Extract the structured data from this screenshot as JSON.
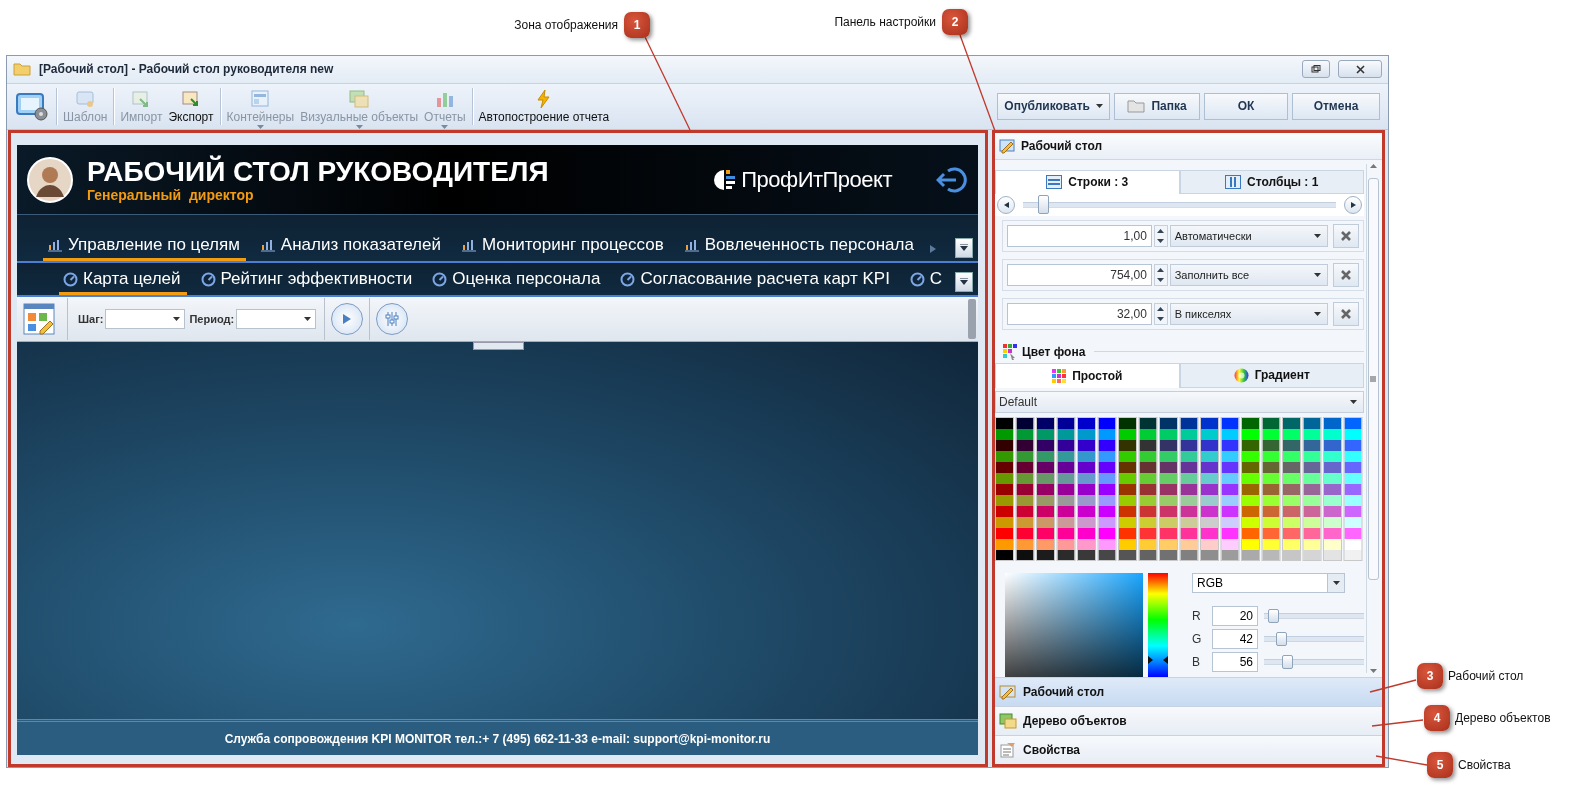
{
  "annotations": [
    {
      "number": "1",
      "label": "Зона отображения"
    },
    {
      "number": "2",
      "label": "Панель настройки"
    },
    {
      "number": "3",
      "label": "Рабочий стол"
    },
    {
      "number": "4",
      "label": "Дерево объектов"
    },
    {
      "number": "5",
      "label": "Свойства"
    }
  ],
  "window": {
    "title": "[Рабочий стол] - Рабочий стол руководителя new"
  },
  "toolbar": {
    "items": [
      {
        "kind": "icon",
        "disabled": false
      },
      {
        "kind": "button",
        "label": "Шаблон",
        "disabled": true,
        "group_start": true
      },
      {
        "kind": "button",
        "label": "Импорт",
        "disabled": true,
        "group_start": true
      },
      {
        "kind": "button",
        "label": "Экспорт",
        "disabled": false
      },
      {
        "kind": "dropdown",
        "label": "Контейнеры",
        "disabled": true,
        "group_start": true
      },
      {
        "kind": "dropdown",
        "label": "Визуальные объекты",
        "disabled": true
      },
      {
        "kind": "dropdown",
        "label": "Отчеты",
        "disabled": true
      },
      {
        "kind": "button",
        "label": "Автопостроение отчета",
        "disabled": false,
        "group_start": true
      }
    ],
    "actions": [
      {
        "kind": "dropdown",
        "label": "Опубликовать"
      },
      {
        "kind": "folder",
        "label": "Папка"
      },
      {
        "kind": "plain",
        "label": "ОК"
      },
      {
        "kind": "plain",
        "label": "Отмена"
      }
    ]
  },
  "dashboard": {
    "title": "РАБОЧИЙ СТОЛ РУКОВОДИТЕЛЯ",
    "subtitle": "Генеральный  директор",
    "brand": "ПрофИтПроект",
    "tabs": [
      {
        "label": "Управление по целям",
        "selected": true
      },
      {
        "label": "Анализ показателей",
        "selected": false
      },
      {
        "label": "Мониторинг процессов",
        "selected": false
      },
      {
        "label": "Вовлеченность персонала",
        "selected": false
      }
    ],
    "subtabs": [
      {
        "label": "Карта целей",
        "selected": true
      },
      {
        "label": "Рейтинг эффективности",
        "selected": false
      },
      {
        "label": "Оценка персонала",
        "selected": false
      },
      {
        "label": "Согласование расчета карт KPI",
        "selected": false
      },
      {
        "label": "С",
        "selected": false
      }
    ],
    "filters": [
      {
        "label": "Шаг:"
      },
      {
        "label": "Период:"
      }
    ],
    "footer": "Служба сопровождения KPI MONITOR тел.:+ 7 (495) 662-11-33 e-mail: support@kpi-monitor.ru"
  },
  "panel": {
    "title": "Рабочий стол",
    "tabs": [
      {
        "label": "Строки : 3",
        "selected": true
      },
      {
        "label": "Столбцы : 1",
        "selected": false
      }
    ],
    "slider": {
      "level": 0.06
    },
    "rows": [
      {
        "value": "1,00",
        "mode": "Автоматически"
      },
      {
        "value": "754,00",
        "mode": "Заполнить все"
      },
      {
        "value": "32,00",
        "mode": "В пикселях"
      }
    ],
    "background": {
      "title": "Цвет фона",
      "tabs": [
        {
          "label": "Простой",
          "selected": true
        },
        {
          "label": "Градиент",
          "selected": false
        }
      ],
      "palette": "Default",
      "model": "RGB",
      "channels": [
        {
          "label": "R",
          "value": "20",
          "level": 0.08
        },
        {
          "label": "G",
          "value": "42",
          "level": 0.16
        },
        {
          "label": "B",
          "value": "56",
          "level": 0.22
        }
      ]
    }
  },
  "accordion": [
    {
      "label": "Рабочий стол",
      "selected": true
    },
    {
      "label": "Дерево объектов",
      "selected": false
    },
    {
      "label": "Свойства",
      "selected": false
    }
  ]
}
